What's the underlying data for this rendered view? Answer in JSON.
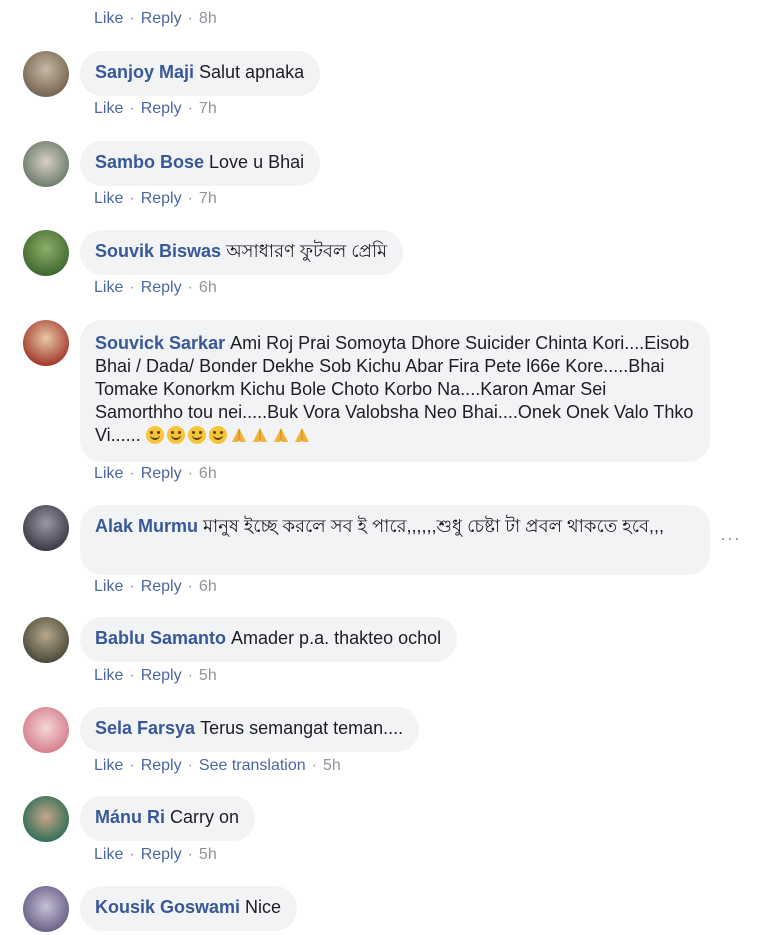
{
  "action_labels": {
    "like": "Like",
    "reply": "Reply",
    "see_translation": "See translation",
    "dot": "·"
  },
  "more_icon_text": "···",
  "top_actions": {
    "time": "8h"
  },
  "comments": [
    {
      "author": "Sanjoy Maji",
      "text": "Salut apnaka",
      "time": "7h"
    },
    {
      "author": "Sambo Bose",
      "text": "Love u Bhai",
      "time": "7h"
    },
    {
      "author": "Souvik Biswas",
      "text": "অসাধারণ ফুটবল প্রেমি",
      "time": "6h"
    },
    {
      "author": "Souvick Sarkar",
      "text": "Ami Roj Prai Somoyta Dhore Suicider Chinta Kori....Eisob Bhai / Dada/ Bonder Dekhe Sob Kichu Abar Fira Pete l66e Kore.....Bhai Tomake Konorkm Kichu Bole Choto Korbo Na....Karon Amar Sei Samorthho tou nei.....Buk Vora Valobsha Neo Bhai....Onek Onek Valo Thko Vi......",
      "emoji": [
        "smile-emoji",
        "smile-emoji",
        "smile-emoji",
        "smile-emoji",
        "pray-emoji",
        "pray-emoji",
        "pray-emoji",
        "pray-emoji"
      ],
      "time": "6h"
    },
    {
      "author": "Alak Murmu",
      "text": "মানুষ ইচ্ছে করলে সব ই পারে,,,,,,শুধু চেষ্টা টা প্রবল থাকতে হবে,,,",
      "time": "6h"
    },
    {
      "author": "Bablu Samanto",
      "text": "Amader p.a. thakteo ochol",
      "time": "5h"
    },
    {
      "author": "Sela Farsya",
      "text": "Terus semangat teman....",
      "time": "5h"
    },
    {
      "author": "Mánu Ri",
      "text": "Carry on",
      "time": "5h"
    },
    {
      "author": "Kousik Goswami",
      "text": "Nice"
    }
  ],
  "colors": {
    "link": "#385898",
    "bubble": "#f2f3f5",
    "meta": "#90949c"
  }
}
